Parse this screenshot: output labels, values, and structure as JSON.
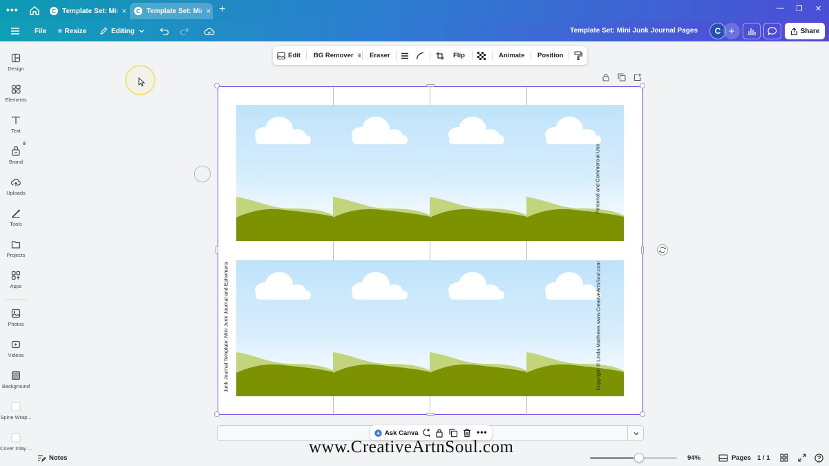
{
  "browser": {
    "tabs": [
      {
        "label": "Template Set: Mini Junk Journal Pages",
        "favicon": "C"
      },
      {
        "label": "Template Set: Mini Junk Journal Pages",
        "favicon": "C"
      }
    ]
  },
  "toolbar": {
    "file_label": "File",
    "resize_label": "Resize",
    "editing_label": "Editing",
    "doc_title": "Template Set: Mini Junk Journal Pages",
    "avatar_initial": "C",
    "share_label": "Share"
  },
  "sidebar": {
    "items": [
      {
        "label": "Design",
        "icon": "design-icon"
      },
      {
        "label": "Elements",
        "icon": "elements-icon"
      },
      {
        "label": "Text",
        "icon": "text-icon"
      },
      {
        "label": "Brand",
        "icon": "brand-icon"
      },
      {
        "label": "Uploads",
        "icon": "uploads-icon"
      },
      {
        "label": "Tools",
        "icon": "tools-icon"
      },
      {
        "label": "Projects",
        "icon": "projects-icon"
      },
      {
        "label": "Apps",
        "icon": "apps-icon"
      },
      {
        "label": "Photos",
        "icon": "photos-icon"
      },
      {
        "label": "Videos",
        "icon": "videos-icon"
      },
      {
        "label": "Background",
        "icon": "background-icon"
      },
      {
        "label": "Spine Wrap...",
        "icon": "spine-wrap-thumbnail"
      },
      {
        "label": "Cover Inlay ...",
        "icon": "cover-inlay-thumbnail"
      }
    ]
  },
  "element_toolbar": {
    "edit_label": "Edit",
    "bg_remover_label": "BG Remover",
    "eraser_label": "Eraser",
    "flip_label": "Flip",
    "animate_label": "Animate",
    "position_label": "Position"
  },
  "canvas": {
    "side_text_right_top": "Personal and Commercial Use",
    "side_text_right_bottom": "Copyright © Linda Matthews www.CreativeArtnSoul.com",
    "side_text_left": "Junk Journal Template: Mini Junk Journal and Ephemera",
    "colors": {
      "sky": "#c3e5fb",
      "hill_light": "#c2d47c",
      "hill_dark": "#7c9200",
      "cloud": "#ffffff",
      "selection": "#7b4df0"
    }
  },
  "bottom": {
    "ask_canva_label": "Ask Canva",
    "notes_label": "Notes",
    "zoom_percent": "94%",
    "zoom_level": 0.5,
    "pages_label": "Pages",
    "page_count": "1 / 1"
  },
  "watermark": "www.CreativeArtnSoul.com"
}
